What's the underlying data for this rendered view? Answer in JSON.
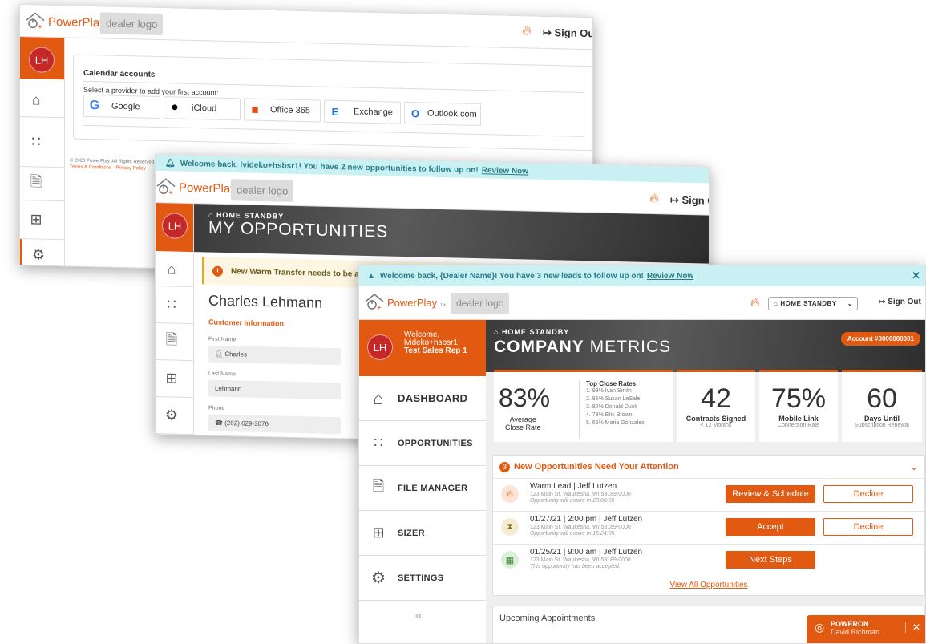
{
  "brand": {
    "name": "PowerPlay",
    "tm": "™",
    "dealer_logo": "dealer logo",
    "accent": "#e25a12"
  },
  "avatar_initials": "LH",
  "sign_out": "Sign Out",
  "sign_out_short1": "Sign Ou",
  "sign_out_short2": "Sign C",
  "win1": {
    "card_title": "Calendar accounts",
    "prompt": "Select a provider to add your first account:",
    "providers": [
      {
        "label": "Google",
        "icon": "google-icon"
      },
      {
        "label": "iCloud",
        "icon": "apple-icon"
      },
      {
        "label": "Office 365",
        "icon": "office-icon"
      },
      {
        "label": "Exchange",
        "icon": "exchange-icon"
      },
      {
        "label": "Outlook.com",
        "icon": "outlook-icon"
      }
    ],
    "footer": "© 2020 PowerPlay. All Rights Reserved",
    "footer_links": "Terms & Conditions · Privacy Policy"
  },
  "win2": {
    "banner": "Welcome back, lvideko+hsbsr1! You have 2 new opportunities to follow up on!",
    "banner_link": "Review Now",
    "kicker": "HOME STANDBY",
    "title": "MY OPPORTUNITIES",
    "alert": "New Warm Transfer needs to be add",
    "customer_name": "Charles Lehmann",
    "section": "Customer Information",
    "first_name_label": "First Name",
    "first_name": "Charles",
    "last_name_label": "Last Name",
    "last_name": "Lehmann",
    "phone_label": "Phone",
    "phone": "(262) 629-3076"
  },
  "win3": {
    "banner": "Welcome back, {Dealer Name}! You have 3 new leads to follow up on!",
    "banner_link": "Review Now",
    "selector": "HOME STANDBY",
    "welcome": "Welcome,",
    "welcome_user": "lvideko+hsbsr1",
    "welcome_role": "Test Sales Rep 1",
    "nav": [
      {
        "label": "DASHBOARD",
        "icon": "home-icon"
      },
      {
        "label": "OPPORTUNITIES",
        "icon": "people-icon"
      },
      {
        "label": "FILE MANAGER",
        "icon": "document-icon"
      },
      {
        "label": "SIZER",
        "icon": "calculator-icon"
      },
      {
        "label": "SETTINGS",
        "icon": "gear-icon"
      }
    ],
    "collapse": "«",
    "kicker": "HOME STANDBY",
    "title_bold": "COMPANY",
    "title_light": "METRICS",
    "account": "Account #0000000001",
    "stats": {
      "close_rate": {
        "value": "83%",
        "l1": "Average",
        "l2": "Close Rate"
      },
      "top_title": "Top Close Rates",
      "top": [
        "1. 99% Ivan Smith",
        "2. 85% Susan LeSale",
        "3. 80% Donald Duck",
        "4. 73% Eric Brown",
        "5. 65% Maria Gonzales"
      ],
      "contracts": {
        "value": "42",
        "l1": "Contracts Signed",
        "l2": "< 12 Months"
      },
      "mobile": {
        "value": "75%",
        "l1": "Mobile Link",
        "l2": "Connection Rate"
      },
      "days": {
        "value": "60",
        "l1": "Days Until",
        "l2": "Subscription Renewal"
      }
    },
    "opps_count": "3",
    "opps_title": "New Opportunities Need Your Attention",
    "opps": [
      {
        "title": "Warm Lead | Jeff Lutzen",
        "addr": "123 Main St. Waukesha, WI 53189-0000",
        "note": "Opportunity will expire in 23:00:05",
        "primary": "Review & Schedule",
        "secondary": "Decline"
      },
      {
        "title": "01/27/21 | 2:00 pm | Jeff Lutzen",
        "addr": "123 Main St. Waukesha, WI 53189-0000",
        "note": "Opportunity will expire in 15:24:05",
        "primary": "Accept",
        "secondary": "Decline"
      },
      {
        "title": "01/25/21 | 9:00 am | Jeff Lutzen",
        "addr": "123 Main St. Waukesha, WI 53189-0000",
        "note": "This opportunity has been accepted.",
        "primary": "Next Steps",
        "secondary": ""
      }
    ],
    "view_all": "View All Opportunities",
    "upcoming": "Upcoming Appointments",
    "poweron": "POWERON",
    "poweron_user": "David Richman"
  }
}
